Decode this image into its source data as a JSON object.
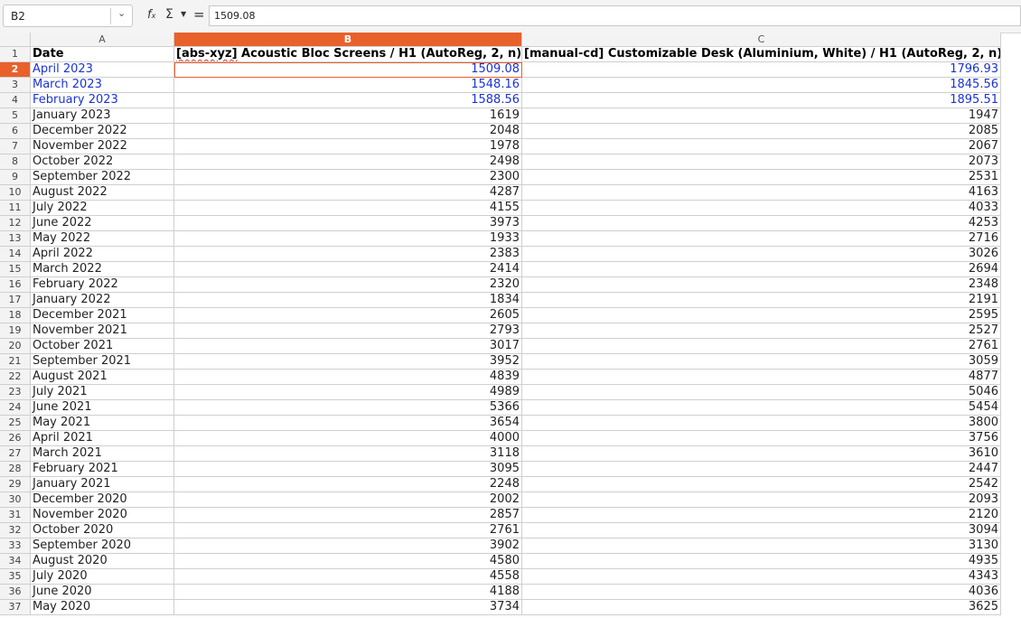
{
  "formula_bar": {
    "cell_ref": "B2",
    "fx_label": "fx",
    "sum_label": "Σ",
    "equals_label": "=",
    "formula": "1509.08"
  },
  "columns": [
    "A",
    "B",
    "C"
  ],
  "headers": {
    "row": "1",
    "a": "Date",
    "b_prefix": "[abs-xyz]",
    "b_rest": " Acoustic Bloc Screens / H1 (AutoReg, 2, n)",
    "c_prefix": "[manual-cd]",
    "c_rest": " Customizable Desk (Aluminium, White) / H1 (AutoReg, 2, n)"
  },
  "rows": [
    {
      "n": "2",
      "date": "April 2023",
      "b": "1509.08",
      "c": "1796.93"
    },
    {
      "n": "3",
      "date": "March 2023",
      "b": "1548.16",
      "c": "1845.56"
    },
    {
      "n": "4",
      "date": "February 2023",
      "b": "1588.56",
      "c": "1895.51"
    },
    {
      "n": "5",
      "date": "January 2023",
      "b": "1619",
      "c": "1947"
    },
    {
      "n": "6",
      "date": "December 2022",
      "b": "2048",
      "c": "2085"
    },
    {
      "n": "7",
      "date": "November 2022",
      "b": "1978",
      "c": "2067"
    },
    {
      "n": "8",
      "date": "October 2022",
      "b": "2498",
      "c": "2073"
    },
    {
      "n": "9",
      "date": "September 2022",
      "b": "2300",
      "c": "2531"
    },
    {
      "n": "10",
      "date": "August 2022",
      "b": "4287",
      "c": "4163"
    },
    {
      "n": "11",
      "date": "July 2022",
      "b": "4155",
      "c": "4033"
    },
    {
      "n": "12",
      "date": "June 2022",
      "b": "3973",
      "c": "4253"
    },
    {
      "n": "13",
      "date": "May 2022",
      "b": "1933",
      "c": "2716"
    },
    {
      "n": "14",
      "date": "April 2022",
      "b": "2383",
      "c": "3026"
    },
    {
      "n": "15",
      "date": "March 2022",
      "b": "2414",
      "c": "2694"
    },
    {
      "n": "16",
      "date": "February 2022",
      "b": "2320",
      "c": "2348"
    },
    {
      "n": "17",
      "date": "January 2022",
      "b": "1834",
      "c": "2191"
    },
    {
      "n": "18",
      "date": "December 2021",
      "b": "2605",
      "c": "2595"
    },
    {
      "n": "19",
      "date": "November 2021",
      "b": "2793",
      "c": "2527"
    },
    {
      "n": "20",
      "date": "October 2021",
      "b": "3017",
      "c": "2761"
    },
    {
      "n": "21",
      "date": "September 2021",
      "b": "3952",
      "c": "3059"
    },
    {
      "n": "22",
      "date": "August 2021",
      "b": "4839",
      "c": "4877"
    },
    {
      "n": "23",
      "date": "July 2021",
      "b": "4989",
      "c": "5046"
    },
    {
      "n": "24",
      "date": "June 2021",
      "b": "5366",
      "c": "5454"
    },
    {
      "n": "25",
      "date": "May 2021",
      "b": "3654",
      "c": "3800"
    },
    {
      "n": "26",
      "date": "April 2021",
      "b": "4000",
      "c": "3756"
    },
    {
      "n": "27",
      "date": "March 2021",
      "b": "3118",
      "c": "3610"
    },
    {
      "n": "28",
      "date": "February 2021",
      "b": "3095",
      "c": "2447"
    },
    {
      "n": "29",
      "date": "January 2021",
      "b": "2248",
      "c": "2542"
    },
    {
      "n": "30",
      "date": "December 2020",
      "b": "2002",
      "c": "2093"
    },
    {
      "n": "31",
      "date": "November 2020",
      "b": "2857",
      "c": "2120"
    },
    {
      "n": "32",
      "date": "October 2020",
      "b": "2761",
      "c": "3094"
    },
    {
      "n": "33",
      "date": "September 2020",
      "b": "3902",
      "c": "3130"
    },
    {
      "n": "34",
      "date": "August 2020",
      "b": "4580",
      "c": "4935"
    },
    {
      "n": "35",
      "date": "July 2020",
      "b": "4558",
      "c": "4343"
    },
    {
      "n": "36",
      "date": "June 2020",
      "b": "4188",
      "c": "4036"
    },
    {
      "n": "37",
      "date": "May 2020",
      "b": "3734",
      "c": "3625"
    }
  ],
  "colors": {
    "accent": "#e8612b",
    "forecast_text": "#1a33d6"
  }
}
